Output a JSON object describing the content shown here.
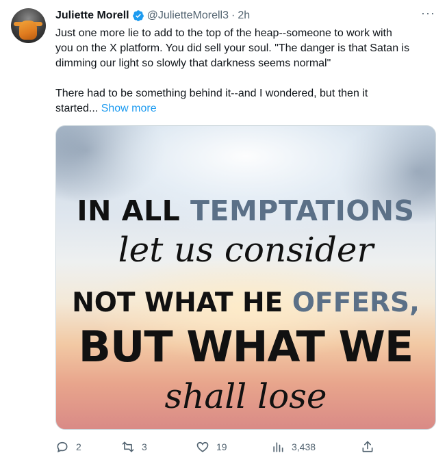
{
  "author": {
    "name": "Juliette Morell",
    "handle": "@JulietteMorell3",
    "separator": "·",
    "time": "2h"
  },
  "tweet": {
    "line1": "Just one more lie to add to the top of the heap--someone to work with",
    "line2": "you on the X platform.  You did sell your soul.  \"The danger is that Satan is",
    "line3": "dimming our light so slowly that darkness seems normal\"",
    "line4": "There had to be something behind it--and I wondered,  but then it",
    "line5": "started...",
    "show_more": "Show more"
  },
  "image": {
    "l1a": "IN ALL ",
    "l1b": "TEMPTATIONS",
    "l2": "let us consider",
    "l3a": "NOT WHAT HE ",
    "l3b": "OFFERS,",
    "l4": "BUT WHAT WE",
    "l5": "shall lose",
    "accent_color": "#5b7087"
  },
  "actions": {
    "reply_count": "2",
    "retweet_count": "3",
    "like_count": "19",
    "views_count": "3,438"
  },
  "colors": {
    "link": "#1d9bf0",
    "muted": "#536471",
    "verified": "#1d9bf0"
  }
}
